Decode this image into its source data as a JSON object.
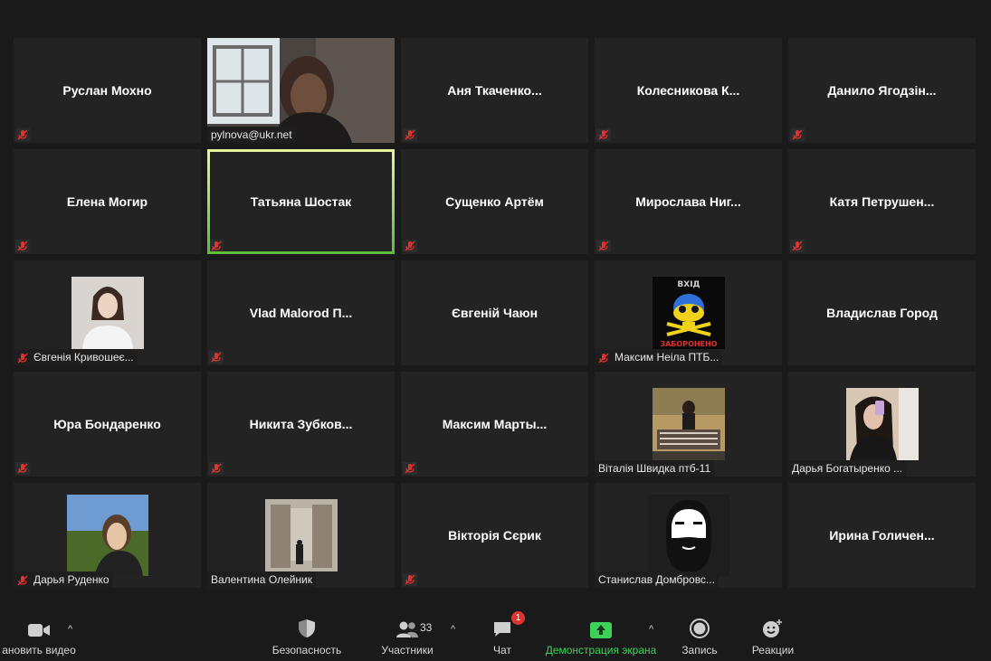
{
  "participants": [
    {
      "name": "Руслан Мохно",
      "muted": true,
      "type": "name"
    },
    {
      "name": "pylnova@ukr.net",
      "muted": false,
      "type": "video"
    },
    {
      "name": "Аня  Ткаченко...",
      "muted": true,
      "type": "name"
    },
    {
      "name": "Колесникова  К...",
      "muted": true,
      "type": "name"
    },
    {
      "name": "Данило  Ягодзін...",
      "muted": true,
      "type": "name"
    },
    {
      "name": "Елена Могир",
      "muted": true,
      "type": "name"
    },
    {
      "name": "Татьяна Шостак",
      "muted": true,
      "type": "name",
      "active": true
    },
    {
      "name": "Сущенко Артём",
      "muted": true,
      "type": "name"
    },
    {
      "name": "Мирослава  Ниг...",
      "muted": true,
      "type": "name"
    },
    {
      "name": "Катя  Петрушен...",
      "muted": true,
      "type": "name"
    },
    {
      "name": "Євгенія Кривошеє...",
      "muted": true,
      "type": "avatar",
      "avatar": "girl-photo"
    },
    {
      "name": "Vlad  Malorod  П...",
      "muted": true,
      "type": "name"
    },
    {
      "name": "Євгеній Чаюн",
      "muted": false,
      "type": "name"
    },
    {
      "name": "Максим Неіла ПТБ...",
      "muted": true,
      "type": "avatar",
      "avatar": "skull-sign",
      "avatar_top_text": "ВХІД",
      "avatar_bottom_text": "ЗАБОРОНЕНО"
    },
    {
      "name": "Владислав Город",
      "muted": false,
      "type": "name"
    },
    {
      "name": "Юра Бондаренко",
      "muted": true,
      "type": "name"
    },
    {
      "name": "Никита  Зубков...",
      "muted": true,
      "type": "name"
    },
    {
      "name": "Максим  Марты...",
      "muted": true,
      "type": "name"
    },
    {
      "name": "Віталія Швидка птб-11",
      "muted": false,
      "type": "avatar",
      "avatar": "bbq-photo"
    },
    {
      "name": "Дарья Богатыренко ...",
      "muted": false,
      "type": "avatar",
      "avatar": "selfie-photo"
    },
    {
      "name": "Дарья Руденко",
      "muted": true,
      "type": "avatar",
      "avatar": "field-photo"
    },
    {
      "name": "Валентина Олейник",
      "muted": false,
      "type": "avatar",
      "avatar": "ruins-photo"
    },
    {
      "name": "Вікторія Сєрик",
      "muted": true,
      "type": "name"
    },
    {
      "name": "Станислав Домбровс...",
      "muted": false,
      "type": "avatar",
      "avatar": "beard-cartoon"
    },
    {
      "name": "Ирина  Голичен...",
      "muted": false,
      "type": "name"
    }
  ],
  "toolbar": {
    "video_label": "ановить видео",
    "security_label": "Безопасность",
    "participants_label": "Участники",
    "participants_count": "33",
    "chat_label": "Чат",
    "chat_badge": "1",
    "share_label": "Демонстрация экрана",
    "record_label": "Запись",
    "reactions_label": "Реакции"
  },
  "colors": {
    "active_border": "#d7ec8a",
    "muted_icon": "#e0322f",
    "share_green": "#3dd15a",
    "tile_bg": "#232323"
  }
}
